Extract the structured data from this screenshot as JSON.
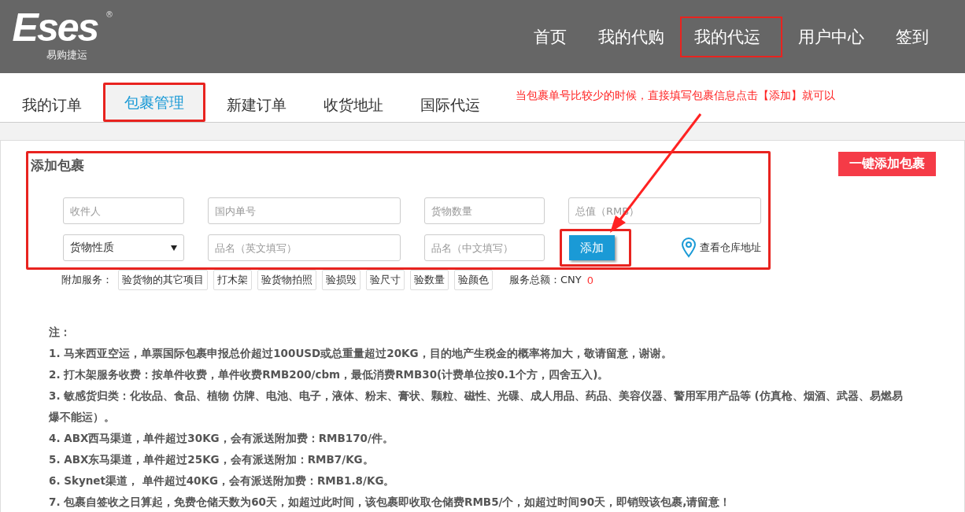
{
  "header": {
    "logo": {
      "wordmark": "Eses",
      "mark": "®",
      "subtitle": "易购捷运"
    },
    "nav": [
      {
        "label": "首页",
        "highlighted": false
      },
      {
        "label": "我的代购",
        "highlighted": false
      },
      {
        "label": "我的代运",
        "highlighted": true
      },
      {
        "label": "用户中心",
        "highlighted": false
      },
      {
        "label": "签到",
        "highlighted": false
      }
    ]
  },
  "tabs": [
    {
      "label": "我的订单",
      "selected": false,
      "highlighted": false
    },
    {
      "label": "包裹管理",
      "selected": true,
      "highlighted": true
    },
    {
      "label": "新建订单",
      "selected": false,
      "highlighted": false
    },
    {
      "label": "收货地址",
      "selected": false,
      "highlighted": false
    },
    {
      "label": "国际代运",
      "selected": false,
      "highlighted": false
    }
  ],
  "annotation": {
    "text": "当包裹单号比较少的时候，直接填写包裹信息点击【添加】就可以"
  },
  "form": {
    "title": "添加包裹",
    "highlighted": true,
    "fields": [
      {
        "kind": "input",
        "placeholder": "收件人"
      },
      {
        "kind": "input",
        "placeholder": "国内单号"
      },
      {
        "kind": "input",
        "placeholder": "货物数量"
      },
      {
        "kind": "input",
        "placeholder": "总值（RMB）"
      },
      {
        "kind": "select",
        "value": "货物性质"
      },
      {
        "kind": "input",
        "placeholder": "品名（英文填写）"
      },
      {
        "kind": "input",
        "placeholder": "品名（中文填写）"
      },
      {
        "kind": "button",
        "label": "添加",
        "highlighted": true
      }
    ],
    "warehouse_link": "查看仓库地址"
  },
  "one_click_button": "一键添加包裹",
  "services": {
    "label": "附加服务：",
    "options": [
      "验货物的其它项目",
      "打木架",
      "验货物拍照",
      "验损毁",
      "验尺寸",
      "验数量",
      "验颜色"
    ],
    "total_label": "服务总额：CNY",
    "total_value": "0"
  },
  "notes": {
    "heading": "注：",
    "items": [
      "1. 马来西亚空运，单票国际包裹申报总价超过100USD或总重量超过20KG，目的地产生税金的概率将加大，敬请留意，谢谢。",
      "2. 打木架服务收费：按单件收费，单件收费RMB200/cbm，最低消费RMB30(计费单位按0.1个方，四舍五入)。",
      "3. 敏感货归类：化妆品、食品、植物 仿牌、电池、电子，液体、粉末、膏状、颗粒、磁性、光碟、成人用品、药品、美容仪器、警用军用产品等 (仿真枪、烟酒、武器、易燃易爆不能运）。",
      "4. ABX西马渠道，单件超过30KG，会有派送附加费：RMB170/件。",
      "5. ABX东马渠道，单件超过25KG，会有派送附加：RMB7/KG。",
      "6. Skynet渠道， 单件超过40KG，会有派送附加费：RMB1.8/KG。",
      "7. 包裹自签收之日算起，免费仓储天数为60天，如超过此时间，该包裹即收取仓储费RMB5/个，如超过时间90天，即销毁该包裹,请留意！"
    ]
  }
}
